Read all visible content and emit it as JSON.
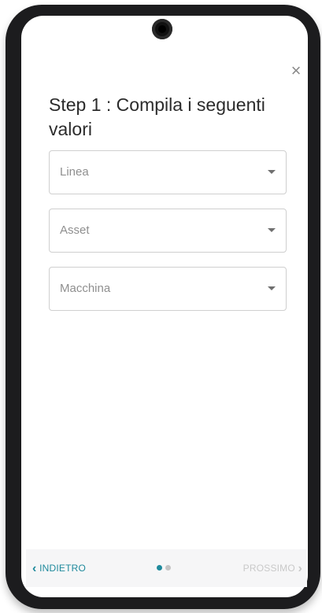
{
  "dialog": {
    "close_glyph": "×",
    "title": "Step 1 : Compila i seguenti valori"
  },
  "form": {
    "fields": [
      {
        "placeholder": "Linea"
      },
      {
        "placeholder": "Asset"
      },
      {
        "placeholder": "Macchina"
      }
    ]
  },
  "footer": {
    "back_label": "INDIETRO",
    "next_label": "PROSSIMO",
    "back_chevron": "‹",
    "next_chevron": "›",
    "step_count": 2,
    "current_step": 1
  },
  "colors": {
    "accent": "#1f8a9c",
    "dot_active": "#1f8a9c",
    "dot_inactive": "#c4c4c4",
    "next_disabled": "#c9c9c9"
  }
}
